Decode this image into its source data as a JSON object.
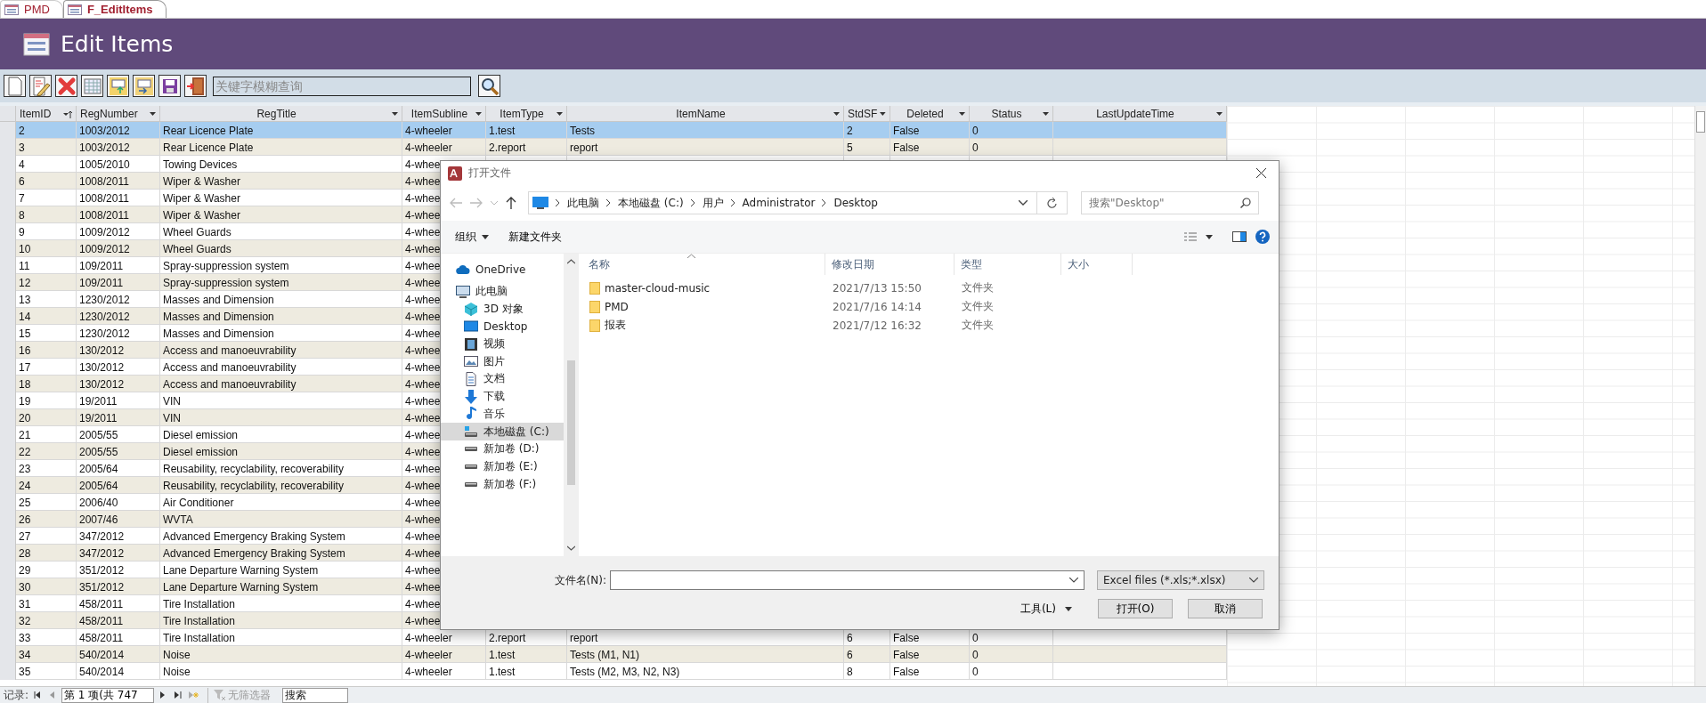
{
  "tabs": [
    {
      "label": "PMD",
      "selected": false
    },
    {
      "label": "F_EditItems",
      "selected": true
    }
  ],
  "header": {
    "title": "Edit Items"
  },
  "toolbar": {
    "search": {
      "placeholder": "关键字模糊查询"
    }
  },
  "table": {
    "columns": [
      {
        "label": "ItemID",
        "sorted": true
      },
      {
        "label": "RegNumber",
        "sorted": false
      },
      {
        "label": "RegTitle",
        "sorted": false
      },
      {
        "label": "ItemSubline",
        "sorted": false
      },
      {
        "label": "ItemType",
        "sorted": false
      },
      {
        "label": "ItemName",
        "sorted": false
      },
      {
        "label": "StdSF",
        "sorted": false
      },
      {
        "label": "Deleted",
        "sorted": false
      },
      {
        "label": "Status",
        "sorted": false
      },
      {
        "label": "LastUpdateTime",
        "sorted": false
      }
    ],
    "rows": [
      {
        "selected": true,
        "cells": [
          "2",
          "1003/2012",
          "Rear Licence Plate",
          "4-wheeler",
          "1.test",
          "Tests",
          "2",
          "False",
          "0"
        ]
      },
      {
        "selected": false,
        "cells": [
          "3",
          "1003/2012",
          "Rear Licence Plate",
          "4-wheeler",
          "2.report",
          "report",
          "5",
          "False",
          "0"
        ]
      },
      {
        "selected": false,
        "cells": [
          "4",
          "1005/2010",
          "Towing Devices",
          "4-whee"
        ]
      },
      {
        "selected": false,
        "cells": [
          "6",
          "1008/2011",
          "Wiper & Washer",
          "4-whee"
        ]
      },
      {
        "selected": false,
        "cells": [
          "7",
          "1008/2011",
          "Wiper & Washer",
          "4-whee"
        ]
      },
      {
        "selected": false,
        "cells": [
          "8",
          "1008/2011",
          "Wiper & Washer",
          "4-whee"
        ]
      },
      {
        "selected": false,
        "cells": [
          "9",
          "1009/2012",
          "Wheel Guards",
          "4-whee"
        ]
      },
      {
        "selected": false,
        "cells": [
          "10",
          "1009/2012",
          "Wheel Guards",
          "4-whee"
        ]
      },
      {
        "selected": false,
        "cells": [
          "11",
          "109/2011",
          "Spray-suppression system",
          "4-whee"
        ]
      },
      {
        "selected": false,
        "cells": [
          "12",
          "109/2011",
          "Spray-suppression system",
          "4-whee"
        ]
      },
      {
        "selected": false,
        "cells": [
          "13",
          "1230/2012",
          "Masses and Dimension",
          "4-whee"
        ]
      },
      {
        "selected": false,
        "cells": [
          "14",
          "1230/2012",
          "Masses and Dimension",
          "4-whee"
        ]
      },
      {
        "selected": false,
        "cells": [
          "15",
          "1230/2012",
          "Masses and Dimension",
          "4-whee"
        ]
      },
      {
        "selected": false,
        "cells": [
          "16",
          "130/2012",
          "Access and manoeuvrability",
          "4-whee"
        ]
      },
      {
        "selected": false,
        "cells": [
          "17",
          "130/2012",
          "Access and manoeuvrability",
          "4-whee"
        ]
      },
      {
        "selected": false,
        "cells": [
          "18",
          "130/2012",
          "Access and manoeuvrability",
          "4-whee"
        ]
      },
      {
        "selected": false,
        "cells": [
          "19",
          "19/2011",
          "VIN",
          "4-whee"
        ]
      },
      {
        "selected": false,
        "cells": [
          "20",
          "19/2011",
          "VIN",
          "4-whee"
        ]
      },
      {
        "selected": false,
        "cells": [
          "21",
          "2005/55",
          "Diesel emission",
          "4-whee"
        ]
      },
      {
        "selected": false,
        "cells": [
          "22",
          "2005/55",
          "Diesel emission",
          "4-whee"
        ]
      },
      {
        "selected": false,
        "cells": [
          "23",
          "2005/64",
          "Reusability, recyclability, recoverability",
          "4-whee"
        ]
      },
      {
        "selected": false,
        "cells": [
          "24",
          "2005/64",
          "Reusability, recyclability, recoverability",
          "4-whee"
        ]
      },
      {
        "selected": false,
        "cells": [
          "25",
          "2006/40",
          "Air Conditioner",
          "4-whee"
        ]
      },
      {
        "selected": false,
        "cells": [
          "26",
          "2007/46",
          "WVTA",
          "4-whee"
        ]
      },
      {
        "selected": false,
        "cells": [
          "27",
          "347/2012",
          "Advanced Emergency Braking System",
          "4-whee"
        ]
      },
      {
        "selected": false,
        "cells": [
          "28",
          "347/2012",
          "Advanced Emergency Braking System",
          "4-whee"
        ]
      },
      {
        "selected": false,
        "cells": [
          "29",
          "351/2012",
          "Lane Departure Warning System",
          "4-whee"
        ]
      },
      {
        "selected": false,
        "cells": [
          "30",
          "351/2012",
          "Lane Departure Warning System",
          "4-whee"
        ]
      },
      {
        "selected": false,
        "cells": [
          "31",
          "458/2011",
          "Tire Installation",
          "4-whee"
        ]
      },
      {
        "selected": false,
        "cells": [
          "32",
          "458/2011",
          "Tire Installation",
          "4-whee"
        ]
      },
      {
        "selected": false,
        "cells": [
          "33",
          "458/2011",
          "Tire Installation",
          "4-wheeler",
          "2.report",
          "report",
          "6",
          "False",
          "0"
        ]
      },
      {
        "selected": false,
        "cells": [
          "34",
          "540/2014",
          "Noise",
          "4-wheeler",
          "1.test",
          "Tests (M1, N1)",
          "6",
          "False",
          "0"
        ]
      },
      {
        "selected": false,
        "cells": [
          "35",
          "540/2014",
          "Noise",
          "4-wheeler",
          "1.test",
          "Tests (M2, M3, N2, N3)",
          "8",
          "False",
          "0"
        ]
      }
    ]
  },
  "dialog": {
    "title": "打开文件",
    "path": [
      "此电脑",
      "本地磁盘 (C:)",
      "用户",
      "Administrator",
      "Desktop"
    ],
    "search": {
      "placeholder": "搜索\"Desktop\""
    },
    "commands": [
      "组织",
      "新建文件夹"
    ],
    "nav": [
      {
        "label": "OneDrive",
        "selected": false
      },
      {
        "label": "此电脑",
        "selected": false,
        "children": [
          {
            "label": "3D 对象",
            "selected": false
          },
          {
            "label": "Desktop",
            "selected": false
          },
          {
            "label": "视频",
            "selected": false
          },
          {
            "label": "图片",
            "selected": false
          },
          {
            "label": "文档",
            "selected": false
          },
          {
            "label": "下载",
            "selected": false
          },
          {
            "label": "音乐",
            "selected": false
          },
          {
            "label": "本地磁盘 (C:)",
            "selected": true
          },
          {
            "label": "新加卷 (D:)",
            "selected": false
          },
          {
            "label": "新加卷 (E:)",
            "selected": false
          },
          {
            "label": "新加卷 (F:)",
            "selected": false
          }
        ]
      }
    ],
    "file_columns": [
      "名称",
      "修改日期",
      "类型",
      "大小"
    ],
    "files": [
      {
        "name": "master-cloud-music",
        "modified": "2021/7/13 15:50",
        "type": "文件夹"
      },
      {
        "name": "PMD",
        "modified": "2021/7/16 14:14",
        "type": "文件夹"
      },
      {
        "name": "报表",
        "modified": "2021/7/12 16:32",
        "type": "文件夹"
      }
    ],
    "filename_label": "文件名(N):",
    "filetype": "Excel files (*.xls;*.xlsx)",
    "tools": "工具(L)",
    "buttons": [
      "打开(O)",
      "取消"
    ]
  },
  "status_bar": {
    "label": "记录:",
    "record": "第 1 项(共 747",
    "filter": "无筛选器",
    "search": {
      "placeholder": "搜索"
    }
  }
}
